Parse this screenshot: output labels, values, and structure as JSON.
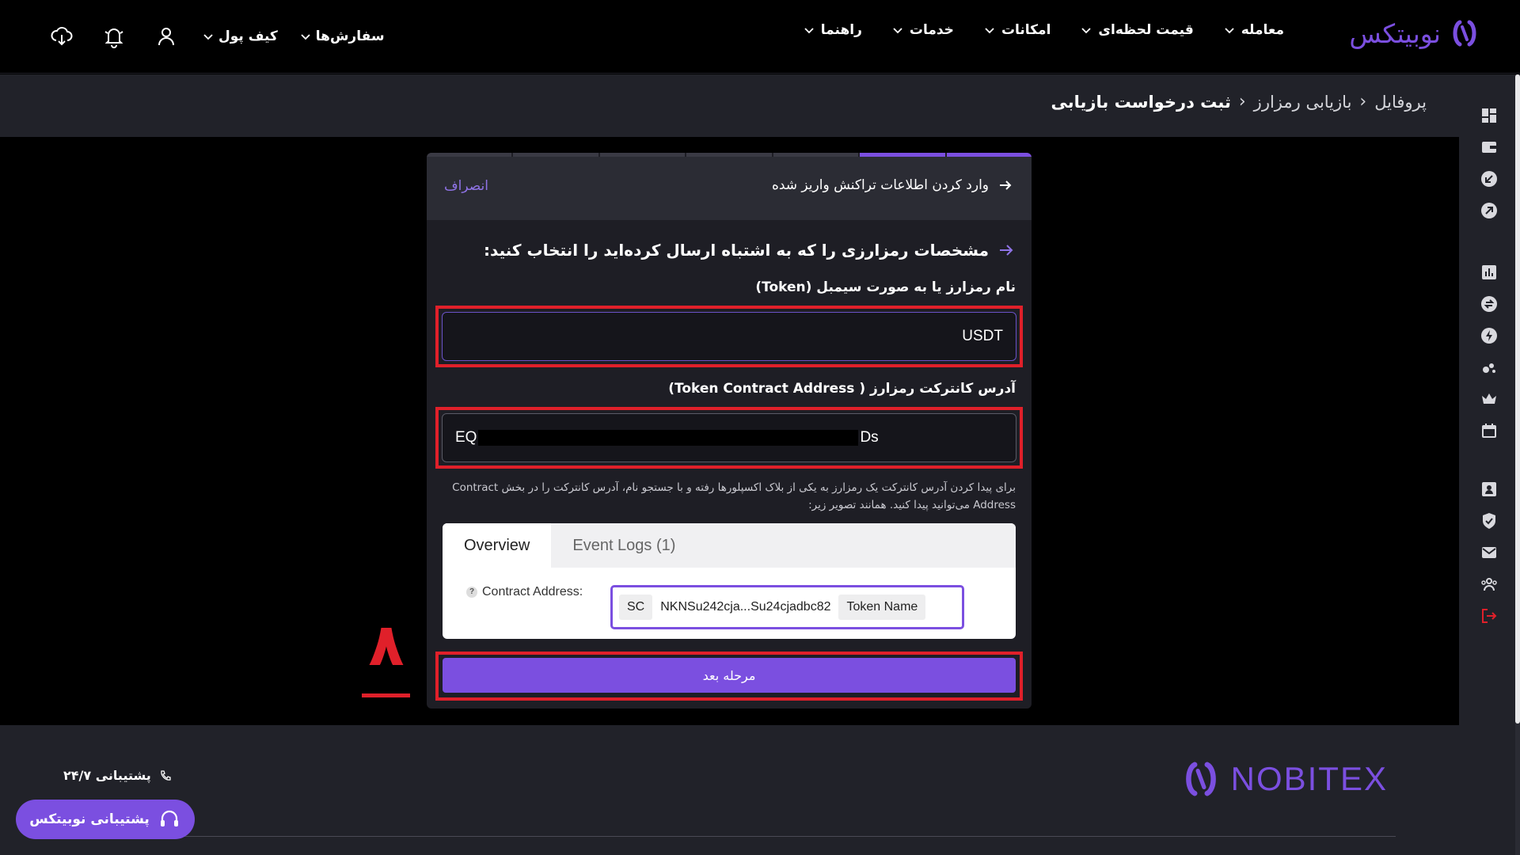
{
  "nav": {
    "brand": "نوبیتکس",
    "menu": [
      "معامله",
      "قیمت لحظه‌ای",
      "امکانات",
      "خدمات",
      "راهنما"
    ],
    "orders": "سفارش‌ها",
    "wallet": "کیف پول"
  },
  "breadcrumb": [
    "پروفایل",
    "بازیابی رمزارز",
    "ثبت درخواست بازیابی"
  ],
  "card": {
    "header_title": "وارد کردن اطلاعات تراکنش واریز شده",
    "cancel": "انصراف",
    "question": "مشخصات رمزارزی را که به اشتباه ارسال کرده‌اید را انتخاب کنید:",
    "token_label": "نام رمزارز یا به صورت سیمبل (Token)",
    "token_value": "USDT",
    "contract_label": "آدرس کانترکت رمزارز ( Token Contract Address)",
    "contract_prefix": "EQ",
    "contract_suffix": "Ds",
    "help": "برای پیدا کردن آدرس کانترکت یک رمزارز به یکی از بلاک اکسپلورها رفته و با جستجو نام، آدرس کانترکت را در بخش Contract Address می‌توانید پیدا کنید. همانند تصویر زیر:",
    "next_button": "مرحله بعد",
    "step_number": "۸"
  },
  "explorer": {
    "tabs": [
      "Overview",
      "Event Logs (1)"
    ],
    "contract_label": "Contract Address:",
    "q_mark": "?",
    "sc": "SC",
    "address": "NKNSu242cja...Su24cjadbc82",
    "token_name": "Token Name"
  },
  "footer": {
    "brand": "NOBITEX",
    "support": "پشتیبانی ۲۴/۷",
    "support_button": "پشتیبانی نوبیتکس"
  },
  "colors": {
    "accent": "#7b4fe0",
    "highlight": "#e0202a",
    "panel": "#212229"
  }
}
